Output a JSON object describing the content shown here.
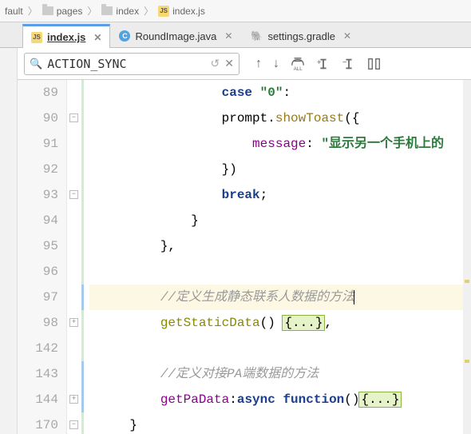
{
  "breadcrumb": {
    "items": [
      {
        "icon": "folder",
        "label": "fault"
      },
      {
        "icon": "folder",
        "label": "pages"
      },
      {
        "icon": "folder",
        "label": "index"
      },
      {
        "icon": "js",
        "label": "index.js"
      }
    ]
  },
  "tabs": [
    {
      "icon": "js",
      "label": "index.js",
      "active": true
    },
    {
      "icon": "c",
      "label": "RoundImage.java",
      "active": false
    },
    {
      "icon": "gradle",
      "label": "settings.gradle",
      "active": false
    }
  ],
  "search": {
    "value": "ACTION_SYNC",
    "icons": {
      "mag": "🔍",
      "history": "↺",
      "clear": "✕",
      "up": "↑",
      "down": "↓",
      "all": "ALL",
      "plus": "+",
      "minus": "−",
      "structure": "⧉"
    }
  },
  "lines": [
    {
      "n": "89",
      "indent": "                ",
      "tokens": [
        {
          "cls": "kw",
          "t": "case"
        },
        {
          "cls": "",
          "t": " "
        },
        {
          "cls": "str",
          "t": "\"0\""
        },
        {
          "cls": "",
          "t": ":"
        }
      ]
    },
    {
      "n": "90",
      "indent": "                ",
      "tokens": [
        {
          "cls": "",
          "t": "prompt."
        },
        {
          "cls": "method",
          "t": "showToast"
        },
        {
          "cls": "",
          "t": "({"
        }
      ]
    },
    {
      "n": "91",
      "indent": "                    ",
      "tokens": [
        {
          "cls": "purple",
          "t": "message"
        },
        {
          "cls": "",
          "t": ": "
        },
        {
          "cls": "str",
          "t": "\"显示另一个手机上的"
        }
      ]
    },
    {
      "n": "92",
      "indent": "                ",
      "tokens": [
        {
          "cls": "",
          "t": "})"
        }
      ]
    },
    {
      "n": "93",
      "indent": "                ",
      "tokens": [
        {
          "cls": "kw",
          "t": "break"
        },
        {
          "cls": "",
          "t": ";"
        }
      ]
    },
    {
      "n": "94",
      "indent": "            ",
      "tokens": [
        {
          "cls": "",
          "t": "}"
        }
      ]
    },
    {
      "n": "95",
      "indent": "        ",
      "tokens": [
        {
          "cls": "",
          "t": "},"
        }
      ]
    },
    {
      "n": "96",
      "indent": "",
      "tokens": []
    },
    {
      "n": "97",
      "indent": "        ",
      "hl": true,
      "caret": true,
      "tokens": [
        {
          "cls": "comment",
          "t": "//定义生成静态联系人数据的方法"
        }
      ]
    },
    {
      "n": "98",
      "indent": "        ",
      "tokens": [
        {
          "cls": "teal",
          "t": "getStaticData"
        },
        {
          "cls": "",
          "t": "() "
        },
        {
          "cls": "fold-box",
          "t": "{...}"
        },
        {
          "cls": "",
          "t": ","
        }
      ]
    },
    {
      "n": "142",
      "indent": "",
      "tokens": []
    },
    {
      "n": "143",
      "indent": "        ",
      "tokens": [
        {
          "cls": "comment",
          "t": "//定义对接PA端数据的方法"
        }
      ]
    },
    {
      "n": "144",
      "indent": "        ",
      "tokens": [
        {
          "cls": "purple",
          "t": "getPaData"
        },
        {
          "cls": "",
          "t": ":"
        },
        {
          "cls": "kw",
          "t": "async function"
        },
        {
          "cls": "",
          "t": "()"
        },
        {
          "cls": "fold-box",
          "t": "{...}"
        }
      ]
    },
    {
      "n": "170",
      "indent": "    ",
      "tokens": [
        {
          "cls": "",
          "t": "}"
        }
      ]
    }
  ],
  "fold_marks": [
    {
      "row": 1,
      "sym": "−"
    },
    {
      "row": 4,
      "sym": "−"
    },
    {
      "row": 9,
      "sym": "+"
    },
    {
      "row": 12,
      "sym": "+"
    },
    {
      "row": 13,
      "sym": "−"
    }
  ],
  "blue_strips": [
    {
      "from": 8,
      "to": 8
    },
    {
      "from": 11,
      "to": 12
    }
  ]
}
